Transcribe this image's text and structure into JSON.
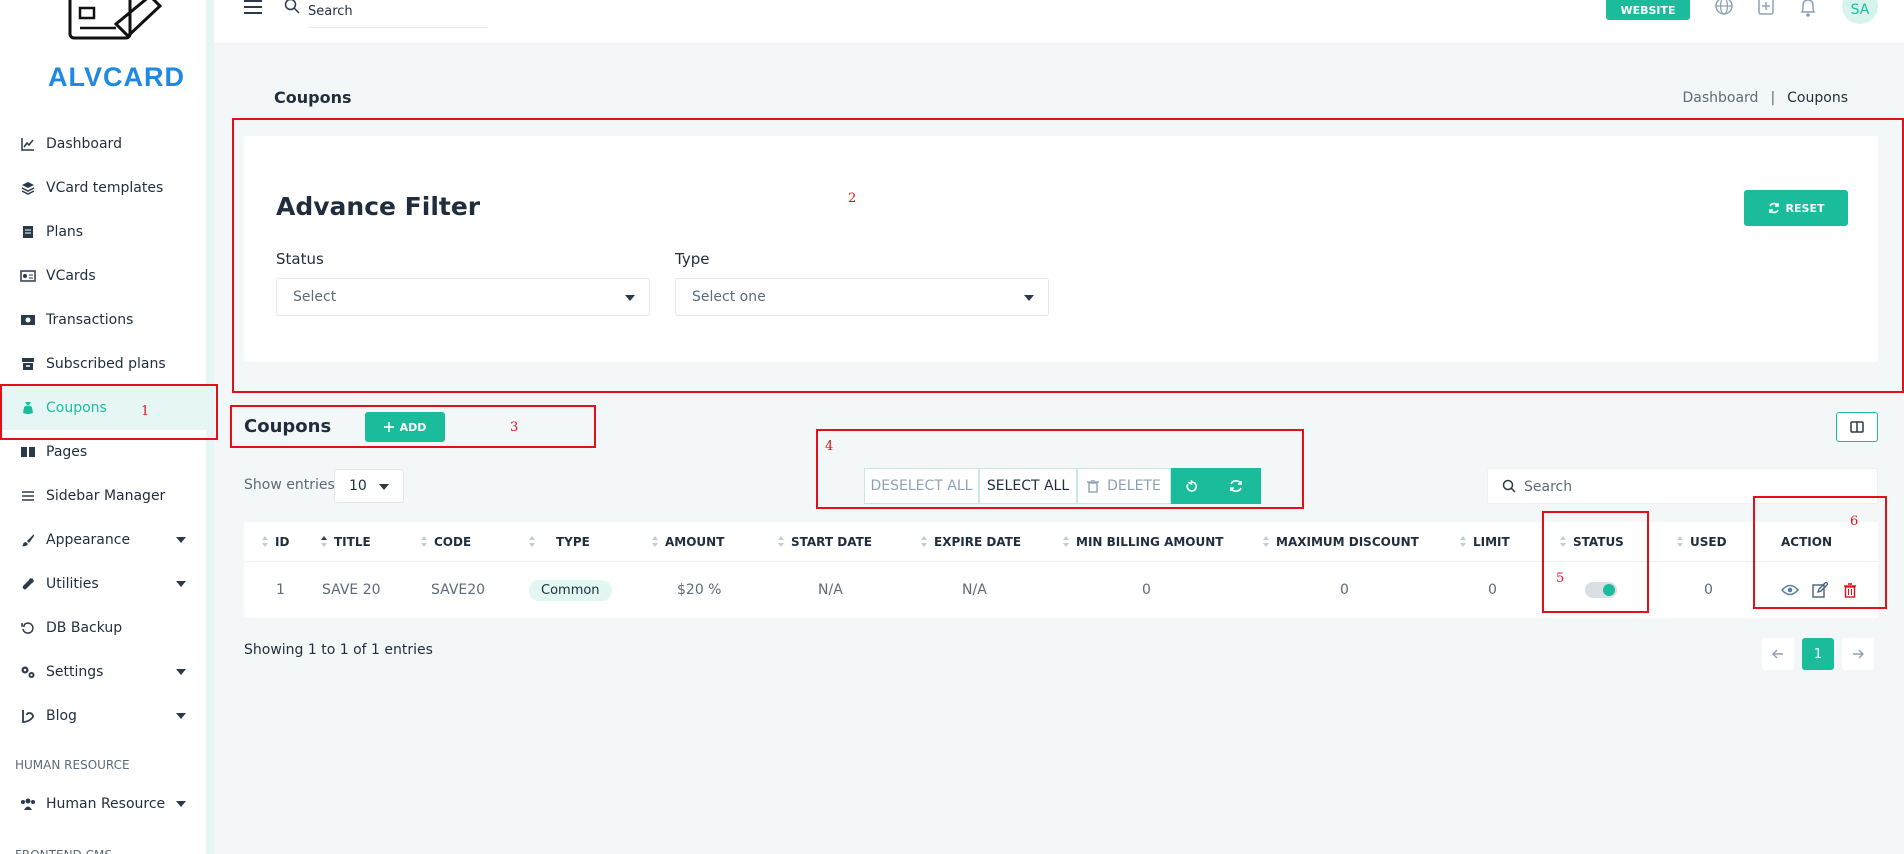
{
  "brand": {
    "name": "ALVCARD",
    "color": "#1e88e5",
    "accent": "#1bbc9b"
  },
  "sidebar": {
    "items": [
      {
        "label": "Dashboard",
        "icon": "chart-line-icon"
      },
      {
        "label": "VCard templates",
        "icon": "layers-icon"
      },
      {
        "label": "Plans",
        "icon": "document-icon"
      },
      {
        "label": "VCards",
        "icon": "id-card-icon"
      },
      {
        "label": "Transactions",
        "icon": "money-icon"
      },
      {
        "label": "Subscribed plans",
        "icon": "archive-icon"
      },
      {
        "label": "Coupons",
        "icon": "coupon-bag-icon",
        "active": true
      },
      {
        "label": "Pages",
        "icon": "book-icon"
      },
      {
        "label": "Sidebar Manager",
        "icon": "list-icon"
      },
      {
        "label": "Appearance",
        "icon": "brush-icon",
        "expandable": true
      },
      {
        "label": "Utilities",
        "icon": "wrench-icon",
        "expandable": true
      },
      {
        "label": "DB Backup",
        "icon": "restore-icon"
      },
      {
        "label": "Settings",
        "icon": "gears-icon",
        "expandable": true
      },
      {
        "label": "Blog",
        "icon": "blog-icon",
        "expandable": true
      }
    ],
    "section_hr": "HUMAN RESOURCE",
    "hr_item": {
      "label": "Human Resource",
      "icon": "users-icon"
    },
    "section_cms": "FRONTEND CMS"
  },
  "topbar": {
    "search_placeholder": "Search",
    "website_label": "WEBSITE",
    "avatar_initials": "SA"
  },
  "header": {
    "title": "Coupons",
    "breadcrumb": [
      "Dashboard",
      "Coupons"
    ]
  },
  "filter": {
    "title": "Advance Filter",
    "reset_label": "RESET",
    "status_label": "Status",
    "status_value": "Select",
    "type_label": "Type",
    "type_value": "Select one"
  },
  "list": {
    "title": "Coupons",
    "add_label": "ADD",
    "show_entries_label": "Show entries",
    "entries_value": "10",
    "search_placeholder": "Search",
    "bulk": {
      "deselect": "DESELECT ALL",
      "select": "SELECT ALL",
      "delete": "DELETE"
    },
    "columns": [
      "ID",
      "TITLE",
      "CODE",
      "TYPE",
      "AMOUNT",
      "START DATE",
      "EXPIRE DATE",
      "MIN BILLING AMOUNT",
      "MAXIMUM DISCOUNT",
      "LIMIT",
      "STATUS",
      "USED",
      "ACTION"
    ],
    "rows": [
      {
        "id": "1",
        "title": "SAVE 20",
        "code": "SAVE20",
        "type": "Common",
        "amount": "$20 %",
        "start": "N/A",
        "expire": "N/A",
        "min_billing": "0",
        "max_discount": "0",
        "limit": "0",
        "status": true,
        "used": "0"
      }
    ],
    "showing": "Showing 1 to 1 of 1 entries",
    "pages": [
      "1"
    ]
  },
  "annotations": [
    "1",
    "2",
    "3",
    "4",
    "5",
    "6"
  ]
}
